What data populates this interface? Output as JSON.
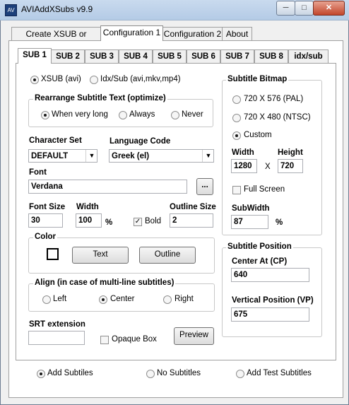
{
  "window": {
    "title": "AVIAddXSubs v9.9"
  },
  "main_tabs": [
    "Create XSUB or Idx/Sub",
    "Configuration 1",
    "Configuration 2",
    "About"
  ],
  "sub_tabs": [
    "SUB 1",
    "SUB 2",
    "SUB 3",
    "SUB 4",
    "SUB 5",
    "SUB 6",
    "SUB 7",
    "SUB 8",
    "idx/sub"
  ],
  "format": {
    "xsub": "XSUB (avi)",
    "idxsub": "Idx/Sub (avi,mkv,mp4)"
  },
  "rearrange": {
    "title": "Rearrange Subtitle Text (optimize)",
    "when_long": "When very long",
    "always": "Always",
    "never": "Never"
  },
  "charset": {
    "label": "Character Set",
    "value": "DEFAULT"
  },
  "language": {
    "label": "Language Code",
    "value": "Greek (el)"
  },
  "font": {
    "label": "Font",
    "value": "Verdana",
    "browse": "..."
  },
  "font_size": {
    "label": "Font Size",
    "value": "30"
  },
  "width": {
    "label": "Width",
    "value": "100",
    "unit": "%"
  },
  "bold": {
    "label": "Bold"
  },
  "outline": {
    "label": "Outline Size",
    "value": "2"
  },
  "color": {
    "title": "Color",
    "text_btn": "Text",
    "outline_btn": "Outline"
  },
  "align": {
    "title": "Align (in case of multi-line subtitles)",
    "left": "Left",
    "center": "Center",
    "right": "Right"
  },
  "srt": {
    "label": "SRT extension",
    "value": ""
  },
  "opaque": {
    "label": "Opaque Box"
  },
  "preview": {
    "label": "Preview"
  },
  "bitmap": {
    "title": "Subtitle Bitmap",
    "pal": "720 X 576 (PAL)",
    "ntsc": "720 X 480 (NTSC)",
    "custom": "Custom",
    "width_label": "Width",
    "height_label": "Height",
    "width_value": "1280",
    "x": "X",
    "height_value": "720",
    "fullscreen": "Full Screen",
    "subwidth_label": "SubWidth",
    "subwidth_value": "87",
    "subwidth_unit": "%"
  },
  "position": {
    "title": "Subtitle Position",
    "center_label": "Center At (CP)",
    "center_value": "640",
    "vertical_label": "Vertical Position (VP)",
    "vertical_value": "675"
  },
  "bottom": {
    "add": "Add Subtiles",
    "none": "No Subtitles",
    "test": "Add Test Subtitles"
  },
  "colors": {
    "text_swatch": "#000000"
  }
}
